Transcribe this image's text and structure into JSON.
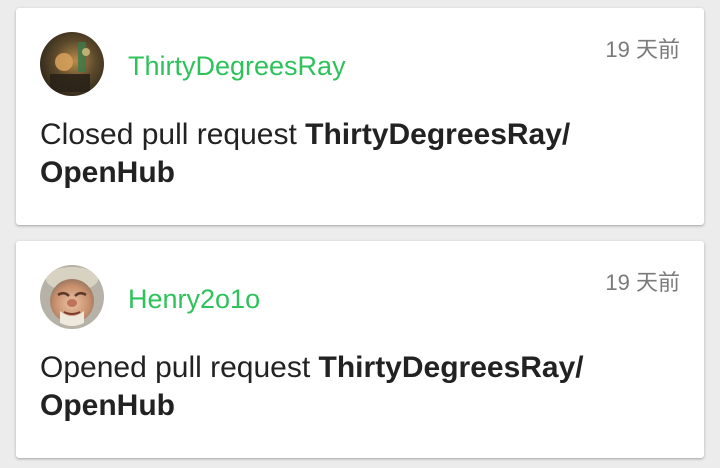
{
  "feed": {
    "events": [
      {
        "username": "ThirtyDegreesRay",
        "time": "19 天前",
        "action_text": "Closed pull request ",
        "repo": "ThirtyDegreesRay/ OpenHub"
      },
      {
        "username": "Henry2o1o",
        "time": "19 天前",
        "action_text": "Opened pull request ",
        "repo": "ThirtyDegreesRay/ OpenHub"
      }
    ]
  },
  "colors": {
    "username": "#2ec25b",
    "time": "#7a7a7a",
    "text": "#222222",
    "background": "#ececec",
    "card": "#ffffff"
  }
}
